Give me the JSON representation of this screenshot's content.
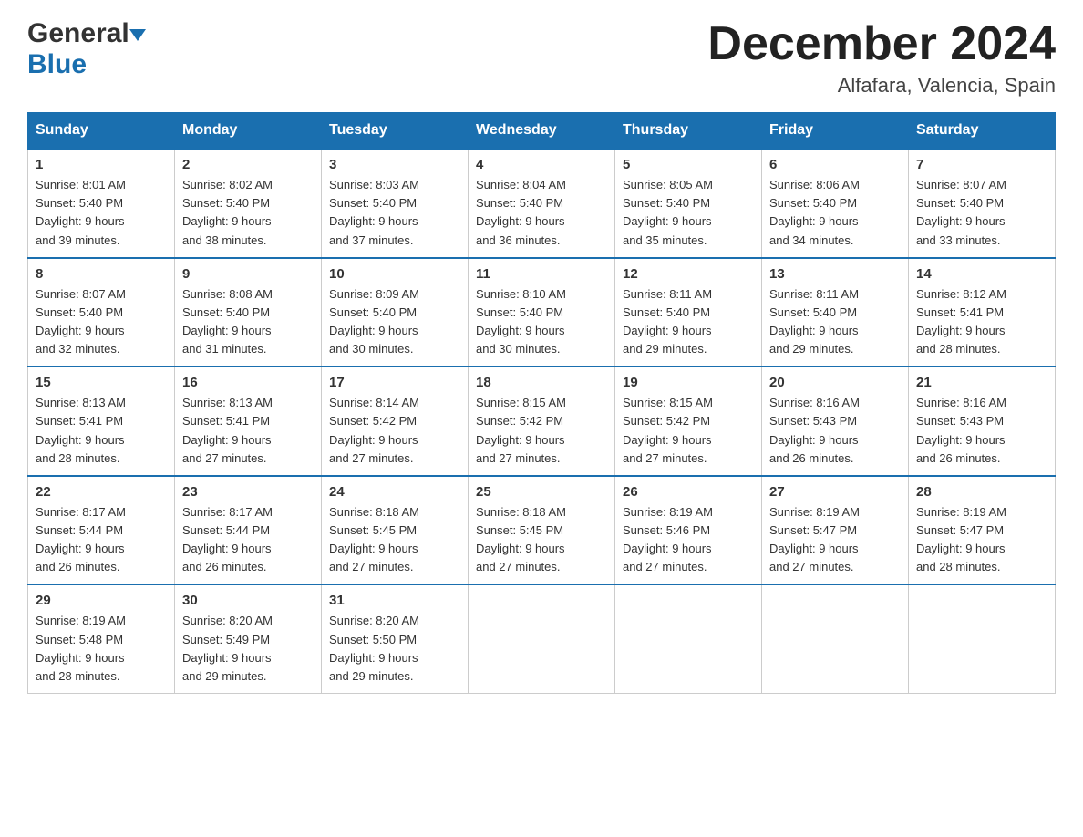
{
  "header": {
    "logo_general": "General",
    "logo_blue": "Blue",
    "month_title": "December 2024",
    "location": "Alfafara, Valencia, Spain"
  },
  "days_of_week": [
    "Sunday",
    "Monday",
    "Tuesday",
    "Wednesday",
    "Thursday",
    "Friday",
    "Saturday"
  ],
  "weeks": [
    [
      {
        "day": "1",
        "sunrise": "Sunrise: 8:01 AM",
        "sunset": "Sunset: 5:40 PM",
        "daylight": "Daylight: 9 hours",
        "daylight2": "and 39 minutes."
      },
      {
        "day": "2",
        "sunrise": "Sunrise: 8:02 AM",
        "sunset": "Sunset: 5:40 PM",
        "daylight": "Daylight: 9 hours",
        "daylight2": "and 38 minutes."
      },
      {
        "day": "3",
        "sunrise": "Sunrise: 8:03 AM",
        "sunset": "Sunset: 5:40 PM",
        "daylight": "Daylight: 9 hours",
        "daylight2": "and 37 minutes."
      },
      {
        "day": "4",
        "sunrise": "Sunrise: 8:04 AM",
        "sunset": "Sunset: 5:40 PM",
        "daylight": "Daylight: 9 hours",
        "daylight2": "and 36 minutes."
      },
      {
        "day": "5",
        "sunrise": "Sunrise: 8:05 AM",
        "sunset": "Sunset: 5:40 PM",
        "daylight": "Daylight: 9 hours",
        "daylight2": "and 35 minutes."
      },
      {
        "day": "6",
        "sunrise": "Sunrise: 8:06 AM",
        "sunset": "Sunset: 5:40 PM",
        "daylight": "Daylight: 9 hours",
        "daylight2": "and 34 minutes."
      },
      {
        "day": "7",
        "sunrise": "Sunrise: 8:07 AM",
        "sunset": "Sunset: 5:40 PM",
        "daylight": "Daylight: 9 hours",
        "daylight2": "and 33 minutes."
      }
    ],
    [
      {
        "day": "8",
        "sunrise": "Sunrise: 8:07 AM",
        "sunset": "Sunset: 5:40 PM",
        "daylight": "Daylight: 9 hours",
        "daylight2": "and 32 minutes."
      },
      {
        "day": "9",
        "sunrise": "Sunrise: 8:08 AM",
        "sunset": "Sunset: 5:40 PM",
        "daylight": "Daylight: 9 hours",
        "daylight2": "and 31 minutes."
      },
      {
        "day": "10",
        "sunrise": "Sunrise: 8:09 AM",
        "sunset": "Sunset: 5:40 PM",
        "daylight": "Daylight: 9 hours",
        "daylight2": "and 30 minutes."
      },
      {
        "day": "11",
        "sunrise": "Sunrise: 8:10 AM",
        "sunset": "Sunset: 5:40 PM",
        "daylight": "Daylight: 9 hours",
        "daylight2": "and 30 minutes."
      },
      {
        "day": "12",
        "sunrise": "Sunrise: 8:11 AM",
        "sunset": "Sunset: 5:40 PM",
        "daylight": "Daylight: 9 hours",
        "daylight2": "and 29 minutes."
      },
      {
        "day": "13",
        "sunrise": "Sunrise: 8:11 AM",
        "sunset": "Sunset: 5:40 PM",
        "daylight": "Daylight: 9 hours",
        "daylight2": "and 29 minutes."
      },
      {
        "day": "14",
        "sunrise": "Sunrise: 8:12 AM",
        "sunset": "Sunset: 5:41 PM",
        "daylight": "Daylight: 9 hours",
        "daylight2": "and 28 minutes."
      }
    ],
    [
      {
        "day": "15",
        "sunrise": "Sunrise: 8:13 AM",
        "sunset": "Sunset: 5:41 PM",
        "daylight": "Daylight: 9 hours",
        "daylight2": "and 28 minutes."
      },
      {
        "day": "16",
        "sunrise": "Sunrise: 8:13 AM",
        "sunset": "Sunset: 5:41 PM",
        "daylight": "Daylight: 9 hours",
        "daylight2": "and 27 minutes."
      },
      {
        "day": "17",
        "sunrise": "Sunrise: 8:14 AM",
        "sunset": "Sunset: 5:42 PM",
        "daylight": "Daylight: 9 hours",
        "daylight2": "and 27 minutes."
      },
      {
        "day": "18",
        "sunrise": "Sunrise: 8:15 AM",
        "sunset": "Sunset: 5:42 PM",
        "daylight": "Daylight: 9 hours",
        "daylight2": "and 27 minutes."
      },
      {
        "day": "19",
        "sunrise": "Sunrise: 8:15 AM",
        "sunset": "Sunset: 5:42 PM",
        "daylight": "Daylight: 9 hours",
        "daylight2": "and 27 minutes."
      },
      {
        "day": "20",
        "sunrise": "Sunrise: 8:16 AM",
        "sunset": "Sunset: 5:43 PM",
        "daylight": "Daylight: 9 hours",
        "daylight2": "and 26 minutes."
      },
      {
        "day": "21",
        "sunrise": "Sunrise: 8:16 AM",
        "sunset": "Sunset: 5:43 PM",
        "daylight": "Daylight: 9 hours",
        "daylight2": "and 26 minutes."
      }
    ],
    [
      {
        "day": "22",
        "sunrise": "Sunrise: 8:17 AM",
        "sunset": "Sunset: 5:44 PM",
        "daylight": "Daylight: 9 hours",
        "daylight2": "and 26 minutes."
      },
      {
        "day": "23",
        "sunrise": "Sunrise: 8:17 AM",
        "sunset": "Sunset: 5:44 PM",
        "daylight": "Daylight: 9 hours",
        "daylight2": "and 26 minutes."
      },
      {
        "day": "24",
        "sunrise": "Sunrise: 8:18 AM",
        "sunset": "Sunset: 5:45 PM",
        "daylight": "Daylight: 9 hours",
        "daylight2": "and 27 minutes."
      },
      {
        "day": "25",
        "sunrise": "Sunrise: 8:18 AM",
        "sunset": "Sunset: 5:45 PM",
        "daylight": "Daylight: 9 hours",
        "daylight2": "and 27 minutes."
      },
      {
        "day": "26",
        "sunrise": "Sunrise: 8:19 AM",
        "sunset": "Sunset: 5:46 PM",
        "daylight": "Daylight: 9 hours",
        "daylight2": "and 27 minutes."
      },
      {
        "day": "27",
        "sunrise": "Sunrise: 8:19 AM",
        "sunset": "Sunset: 5:47 PM",
        "daylight": "Daylight: 9 hours",
        "daylight2": "and 27 minutes."
      },
      {
        "day": "28",
        "sunrise": "Sunrise: 8:19 AM",
        "sunset": "Sunset: 5:47 PM",
        "daylight": "Daylight: 9 hours",
        "daylight2": "and 28 minutes."
      }
    ],
    [
      {
        "day": "29",
        "sunrise": "Sunrise: 8:19 AM",
        "sunset": "Sunset: 5:48 PM",
        "daylight": "Daylight: 9 hours",
        "daylight2": "and 28 minutes."
      },
      {
        "day": "30",
        "sunrise": "Sunrise: 8:20 AM",
        "sunset": "Sunset: 5:49 PM",
        "daylight": "Daylight: 9 hours",
        "daylight2": "and 29 minutes."
      },
      {
        "day": "31",
        "sunrise": "Sunrise: 8:20 AM",
        "sunset": "Sunset: 5:50 PM",
        "daylight": "Daylight: 9 hours",
        "daylight2": "and 29 minutes."
      },
      {
        "day": "",
        "sunrise": "",
        "sunset": "",
        "daylight": "",
        "daylight2": ""
      },
      {
        "day": "",
        "sunrise": "",
        "sunset": "",
        "daylight": "",
        "daylight2": ""
      },
      {
        "day": "",
        "sunrise": "",
        "sunset": "",
        "daylight": "",
        "daylight2": ""
      },
      {
        "day": "",
        "sunrise": "",
        "sunset": "",
        "daylight": "",
        "daylight2": ""
      }
    ]
  ]
}
